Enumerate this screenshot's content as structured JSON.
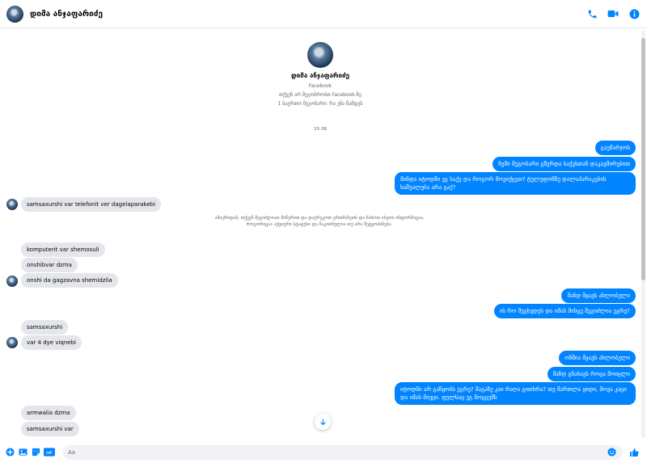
{
  "header": {
    "contact_name": "დიმა ანჯაფარიძე",
    "icons": [
      "phone-icon",
      "video-icon",
      "info-icon"
    ]
  },
  "profile": {
    "name": "დიმა ანჯაფარიძე",
    "platform": "Facebook",
    "friend_status": "თქვენ არ მეგობრობთ Facebook-ზე",
    "mutual": "1 საერთო მეგობარი: რა ენა წამდეს"
  },
  "timestamp": "15:38",
  "notice": "ამიერიდან, თქვენ შეგიძლიათ მიწერით და დაურეკოთ ერთმანეთს და ნახოთ ისეთი ინფორმაცია, როგორიცაა აქტიური სტატუსი და წაკითხულია თუ არა შეტყობინება.",
  "messages": {
    "m1": "გაუმარჯოს",
    "m2": "ჩემი მეგობარი გწერდა საქვსთან დაკავშირებით",
    "m3": "მინდა იტოდში ეგ საქე და როგორ მოვიქცეთ? ტელეფონზე დალაპარაკების საშუალება არა გაქ?",
    "m4": "samsaxurshi var telefonit ver dagelaparakebi",
    "m5": "komputerit var shemosuli",
    "m6": "onshibvar dzma",
    "m7": "onshi da gagzavna shemidzlia",
    "m8": "მანდ მყავს ახლობელი",
    "m9": "ის რო შეგხვდეს და იმას მისცე შეგიძლია ეგრე?",
    "m10": "samsaxurshi",
    "m11": "var 4 dye viqnebi",
    "m12": "ონშია მყავს ახლობელი",
    "m13": "მანდ გნახავს როცა მოიცლი",
    "m14": "იტოდში არ გაწყობს ეგრე? მაგაზე კაი რაღა გითხრა? თუ მართლა ყიდი, მოვა კაცი და იმას მიეცი. ფულსაც ეგ მოგცემს",
    "m15": "armwalia dzma",
    "m16": "samsaxurshi var"
  },
  "composer": {
    "placeholder": "Aa",
    "icons": [
      "plus-icon",
      "image-icon",
      "sticker-icon",
      "gif-icon",
      "emoji-icon",
      "like-icon"
    ],
    "gif_label": "GIF"
  },
  "colors": {
    "accent": "#0084ff",
    "incoming_bubble": "#e4e6eb",
    "meta_text": "#65676b"
  }
}
